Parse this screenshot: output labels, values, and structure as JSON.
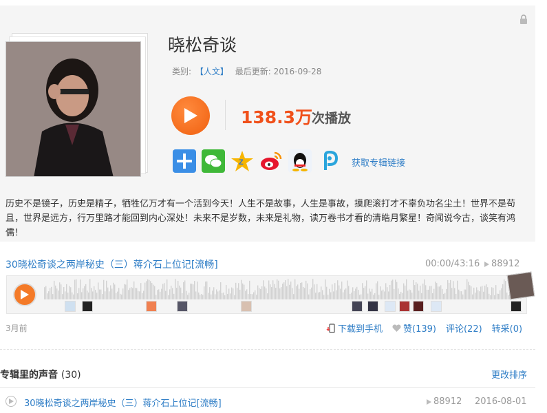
{
  "album": {
    "title": "晓松奇谈",
    "category_label": "类别:",
    "category": "【人文】",
    "updated_label": "最后更新:",
    "updated": "2016-09-28",
    "play_count": "138.3万",
    "play_count_label": "次播放",
    "share_icons": [
      "add-share-icon",
      "wechat-icon",
      "qzone-icon",
      "weibo-icon",
      "qq-icon",
      "pengyou-icon"
    ],
    "get_link": "获取专辑链接",
    "description": "历史不是镜子，历史是精子，牺牲亿万才有一个活到今天！人生不是故事，人生是事故，摸爬滚打才不辜负功名尘土！世界不是苟且，世界是远方，行万里路才能回到内心深处！未来不是岁数，未来是礼物，读万卷书才看的清皓月繁星！奇闻说今古，谈笑有鸿儒！"
  },
  "current_track": {
    "title": "30晓松奇谈之两岸秘史（三）蒋介石上位记[流畅]",
    "time": "00:00/43:16",
    "plays": "88912",
    "ago": "3月前",
    "download": "下载到手机",
    "like": "赞(139)",
    "comment": "评论(22)",
    "repost": "转采(0)"
  },
  "tracks_section": {
    "title": "专辑里的声音",
    "count": "(30)",
    "sort": "更改排序",
    "items": [
      {
        "title": "30晓松奇谈之两岸秘史（三）蒋介石上位记[流畅]",
        "plays": "88912",
        "date": "2016-08-01"
      }
    ]
  },
  "colors": {
    "accent": "#f06010",
    "link": "#2e7dc6",
    "count": "#f0501a"
  }
}
